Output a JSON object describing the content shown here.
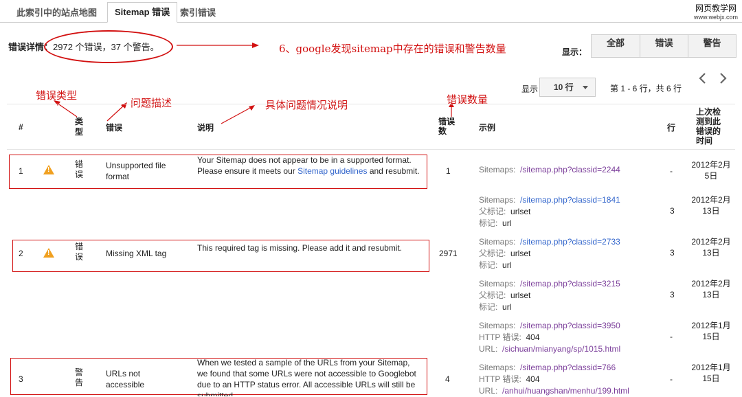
{
  "tabs": [
    {
      "label": "此索引中的站点地图"
    },
    {
      "label": "Sitemap 错误"
    },
    {
      "label": "索引错误"
    }
  ],
  "watermark": {
    "line1": "网页教学网",
    "line2": "www.webjx.com"
  },
  "summary": {
    "label": "错误详情：",
    "text": "2972 个错误，37 个警告。"
  },
  "annotations": {
    "main": "6、google发现sitemap中存在的错误和警告数量",
    "type": "错误类型",
    "desc": "问题描述",
    "detail": "具体问题情况说明",
    "count": "错误数量"
  },
  "filter": {
    "show_label": "显示：",
    "buttons": [
      "全部",
      "错误",
      "警告"
    ]
  },
  "pagination": {
    "show_label": "显示",
    "rows_value": "10 行",
    "range_text": "第 1 - 6 行，共 6 行"
  },
  "columns": [
    "#",
    "类型",
    "错误",
    "说明",
    "错误数",
    "示例",
    "行",
    "上次检测到此错误的时间"
  ],
  "rows": [
    {
      "num": "1",
      "type": "错误",
      "error": "Unsupported file format",
      "desc_pre": "Your Sitemap does not appear to be in a supported format. Please ensure it meets our ",
      "desc_link": "Sitemap guidelines",
      "desc_post": " and resubmit.",
      "count": "1"
    },
    {
      "num": "2",
      "type": "错误",
      "error": "Missing XML tag",
      "desc": "This required tag is missing. Please add it and resubmit.",
      "count": "2971"
    },
    {
      "num": "3",
      "type": "警告",
      "error": "URLs not accessible",
      "desc": "When we tested a sample of the URLs from your Sitemap, we found that some URLs were not accessible to Googlebot due to an HTTP status error. All accessible URLs will still be submitted.",
      "count": "4"
    }
  ],
  "examples": [
    {
      "sitemap_label": "Sitemaps:",
      "sitemap_url": "/sitemap.php?classid=2244",
      "line": "-",
      "date": "2012年2月5日"
    },
    {
      "sitemap_label": "Sitemaps:",
      "sitemap_url": "/sitemap.php?classid=1841",
      "parent_label": "父标记:",
      "parent": "urlset",
      "tag_label": "标记:",
      "tag": "url",
      "line": "3",
      "date": "2012年2月13日"
    },
    {
      "sitemap_label": "Sitemaps:",
      "sitemap_url": "/sitemap.php?classid=2733",
      "parent_label": "父标记:",
      "parent": "urlset",
      "tag_label": "标记:",
      "tag": "url",
      "line": "3",
      "date": "2012年2月13日"
    },
    {
      "sitemap_label": "Sitemaps:",
      "sitemap_url": "/sitemap.php?classid=3215",
      "parent_label": "父标记:",
      "parent": "urlset",
      "tag_label": "标记:",
      "tag": "url",
      "line": "3",
      "date": "2012年2月13日"
    },
    {
      "sitemap_label": "Sitemaps:",
      "sitemap_url": "/sitemap.php?classid=3950",
      "http_label": "HTTP 错误:",
      "http": "404",
      "url_label": "URL:",
      "url": "/sichuan/mianyang/sp/1015.html",
      "line": "-",
      "date": "2012年1月15日"
    },
    {
      "sitemap_label": "Sitemaps:",
      "sitemap_url": "/sitemap.php?classid=766",
      "http_label": "HTTP 错误:",
      "http": "404",
      "url_label": "URL:",
      "url": "/anhui/huangshan/menhu/199.html",
      "line": "-",
      "date": "2012年1月15日"
    }
  ],
  "colors": {
    "accent_red": "#d21010",
    "link_blue": "#3366cc",
    "link_visited": "#7b3e9a",
    "warning": "#f0a020"
  },
  "icons": [
    "warning-icon",
    "chevron-left-icon",
    "chevron-right-icon",
    "dropdown-arrow-icon"
  ]
}
